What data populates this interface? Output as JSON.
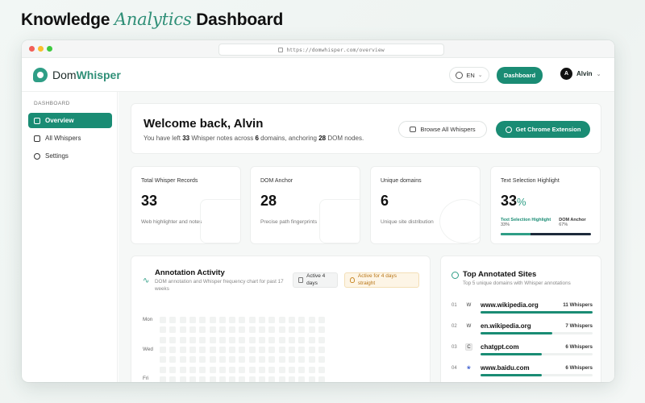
{
  "heading": {
    "pre": "Knowledge",
    "accent": "Analytics",
    "post": "Dashboard"
  },
  "browser": {
    "url": "https://domwhisper.com/overview"
  },
  "header": {
    "logo_pre": "Dom",
    "logo_brand": "Whisper",
    "language": "EN",
    "dashboard_label": "Dashboard",
    "user_initial": "A",
    "user_name": "Alvin"
  },
  "sidebar": {
    "section": "DASHBOARD",
    "items": [
      {
        "label": "Overview",
        "icon": "panel-icon",
        "active": true
      },
      {
        "label": "All Whispers",
        "icon": "chat-icon",
        "active": false
      },
      {
        "label": "Settings",
        "icon": "gear-icon",
        "active": false
      }
    ]
  },
  "welcome": {
    "title": "Welcome back, Alvin",
    "line_a": "You have left ",
    "notes": "33",
    "line_b": " Whisper notes across ",
    "domains": "6",
    "line_c": " domains, anchoring ",
    "nodes": "28",
    "line_d": " DOM nodes.",
    "browse_label": "Browse All Whispers",
    "extension_label": "Get Chrome Extension"
  },
  "stats": [
    {
      "label": "Total Whisper Records",
      "value": "33",
      "sub": "Web highlighter and notes"
    },
    {
      "label": "DOM Anchor",
      "value": "28",
      "sub": "Precise path fingerprints"
    },
    {
      "label": "Unique domains",
      "value": "6",
      "sub": "Unique site distribution"
    },
    {
      "label": "Text Selection Highlight",
      "value": "33",
      "unit": "%",
      "legend_a": "Text Selection Highlight",
      "legend_a_pct": "33%",
      "legend_b": "DOM Anchor",
      "legend_b_pct": "67%",
      "fill_fraction": 0.33
    }
  ],
  "activity": {
    "title": "Annotation Activity",
    "desc": "DOM annotation and Whisper frequency chart for past 17 weeks",
    "chip_active": "Active 4 days",
    "chip_streak": "Active for 4 days straight",
    "days": [
      "Mon",
      "Wed",
      "Fri"
    ]
  },
  "sites": {
    "title": "Top Annotated Sites",
    "desc": "Top 5 unique domains with Whisper annotations",
    "rows": [
      {
        "num": "01",
        "fav": "W",
        "domain": "www.wikipedia.org",
        "count": "11 Whispers",
        "fraction": 1.0
      },
      {
        "num": "02",
        "fav": "W",
        "domain": "en.wikipedia.org",
        "count": "7 Whispers",
        "fraction": 0.64
      },
      {
        "num": "03",
        "fav": "C",
        "domain": "chatgpt.com",
        "count": "6 Whispers",
        "fraction": 0.55
      },
      {
        "num": "04",
        "fav": "❀",
        "domain": "www.baidu.com",
        "count": "6 Whispers",
        "fraction": 0.55
      }
    ]
  },
  "colors": {
    "accent": "#1a8c74",
    "accent_light": "#2f9e86",
    "streak": "#b87516"
  }
}
